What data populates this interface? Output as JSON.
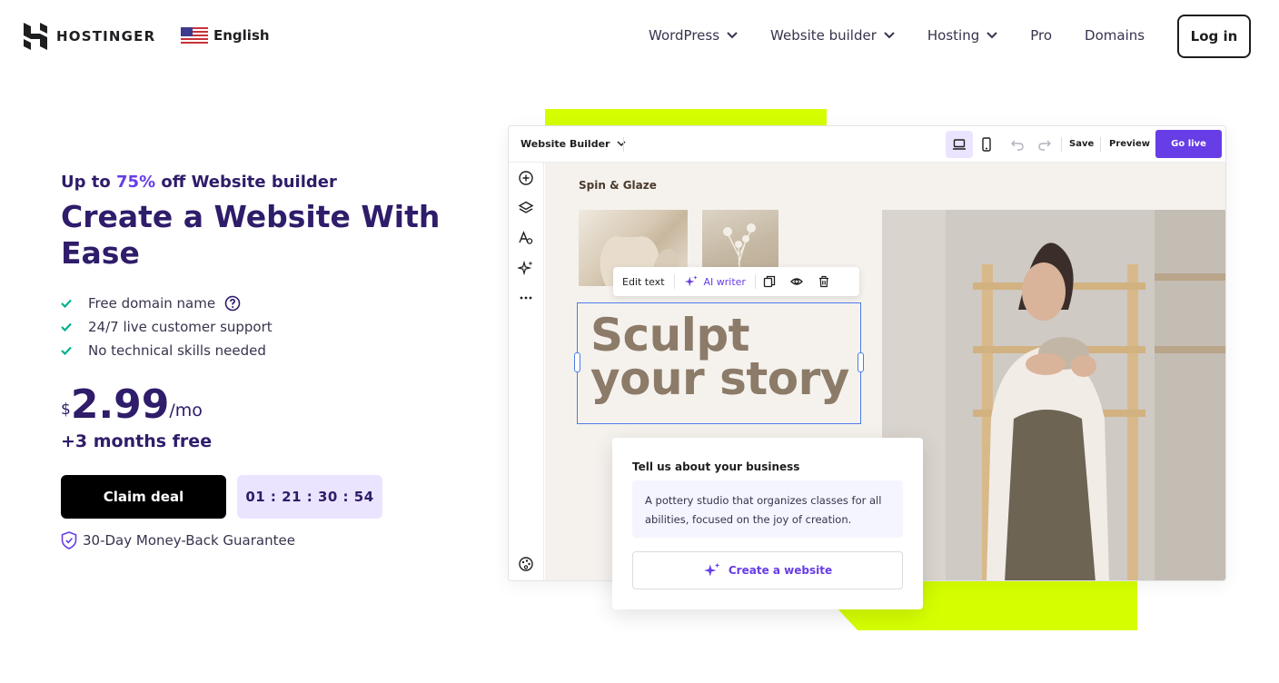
{
  "header": {
    "brand": "HOSTINGER",
    "language": "English",
    "nav": [
      {
        "label": "WordPress"
      },
      {
        "label": "Website builder"
      },
      {
        "label": "Hosting"
      },
      {
        "label": "Pro"
      },
      {
        "label": "Domains"
      }
    ],
    "login_label": "Log in"
  },
  "hero": {
    "promo_prefix": "Up to ",
    "promo_accent": "75%",
    "promo_suffix": " off Website builder",
    "headline": "Create a Website With Ease",
    "features": [
      "Free domain name",
      "24/7 live customer support",
      "No technical skills needed"
    ],
    "price_currency": "$",
    "price_value": "2.99",
    "price_period": "/mo",
    "bonus": "+3 months free",
    "claim_label": "Claim deal",
    "timer": "01 : 21 : 30 : 54",
    "guarantee": "30-Day Money-Back Guarantee"
  },
  "editor": {
    "title": "Website Builder",
    "save": "Save",
    "preview": "Preview",
    "go_live": "Go live",
    "site_name": "Spin & Glaze",
    "toolbar": {
      "edit_text": "Edit text",
      "ai_writer": "AI writer"
    },
    "hero_line1": "Sculpt",
    "hero_line2": "your story",
    "business_card": {
      "title": "Tell us about your business",
      "description": "A pottery studio that organizes classes for all abilities, focused on the joy of creation.",
      "create_label": "Create a website"
    }
  },
  "colors": {
    "brand_purple": "#673de6",
    "navy": "#2f1c6a",
    "lime": "#d5ff00",
    "timer_bg": "#ebe4ff",
    "check_green": "#00b090"
  },
  "icons": [
    "hostinger-logo-icon",
    "us-flag-icon",
    "chevron-down-icon",
    "check-icon",
    "help-icon",
    "shield-icon",
    "laptop-icon",
    "phone-icon",
    "undo-icon",
    "redo-icon",
    "plus-circle-icon",
    "layers-icon",
    "text-style-icon",
    "sparkles-icon",
    "more-icon",
    "palette-icon",
    "copy-icon",
    "eye-icon",
    "trash-icon"
  ]
}
